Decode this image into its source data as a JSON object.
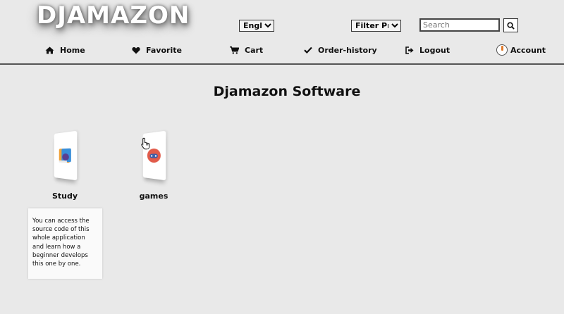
{
  "header": {
    "logo": "DJAMAZON",
    "language": {
      "selected": "English",
      "options": [
        "English"
      ]
    },
    "filter": {
      "selected": "Filter Price",
      "options": [
        "Filter Price"
      ]
    },
    "search": {
      "placeholder": "Search",
      "icon": "search-icon"
    }
  },
  "nav": {
    "home": {
      "label": "Home",
      "icon": "home-icon"
    },
    "favorite": {
      "label": "Favorite",
      "icon": "heart-icon"
    },
    "cart": {
      "label": "Cart",
      "icon": "cart-icon"
    },
    "orders": {
      "label": "Order-history",
      "icon": "check-icon"
    },
    "logout": {
      "label": "Logout",
      "icon": "sign-out-icon"
    },
    "account": {
      "label": "Account",
      "icon": "avatar"
    }
  },
  "main": {
    "title": "Djamazon Software",
    "categories": [
      {
        "label": "Study",
        "icon": "book-icon"
      },
      {
        "label": "games",
        "icon": "gamepad-icon"
      }
    ],
    "tooltip": "You can access the source code of this whole application and learn how a beginner develops this one by one."
  },
  "colors": {
    "background": "#e9e9e9",
    "header_border": "#555555",
    "study_icon": "#f0a23a",
    "games_icon": "#e15b4a"
  }
}
